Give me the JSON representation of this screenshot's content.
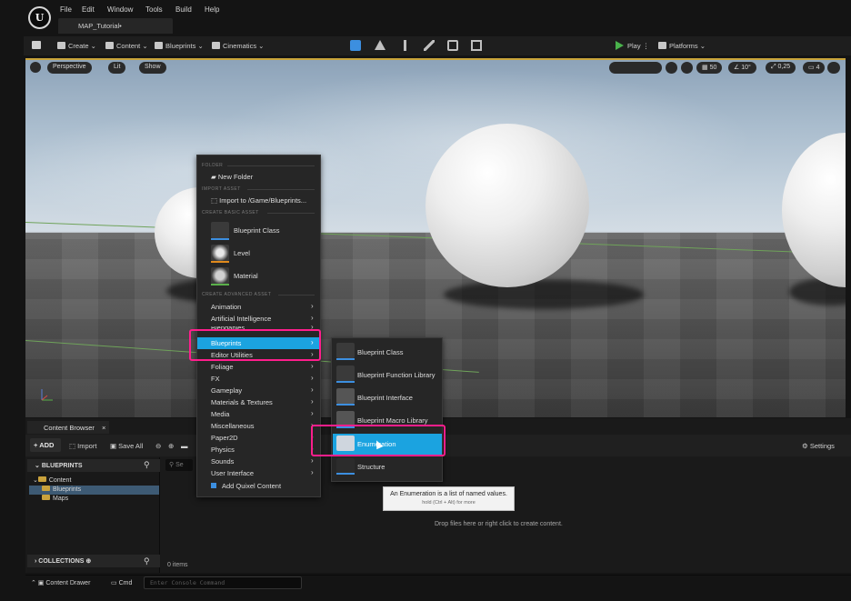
{
  "menubar": {
    "logo": "U",
    "items": [
      "File",
      "Edit",
      "Window",
      "Tools",
      "Build",
      "Help"
    ],
    "level_tab": "MAP_Tutorial•"
  },
  "toolbar": {
    "create": "Create",
    "content": "Content",
    "blueprints": "Blueprints",
    "cinematics": "Cinematics",
    "play": "Play",
    "platforms": "Platforms"
  },
  "viewport": {
    "perspective": "Perspective",
    "lit": "Lit",
    "show": "Show",
    "grid_snap": "50",
    "rot_snap": "10°",
    "scale_snap": "0,25",
    "camera_speed": "4",
    "accent_color": "#c9a43a"
  },
  "context_menu": {
    "sections": {
      "folder": "FOLDER",
      "import": "IMPORT ASSET",
      "basic": "CREATE BASIC ASSET",
      "advanced": "CREATE ADVANCED ASSET"
    },
    "new_folder": "New Folder",
    "import_to": "Import to /Game/Blueprints...",
    "basic_assets": [
      {
        "label": "Blueprint Class",
        "icon": "blueprint-class-icon",
        "color": "#3c8fe0"
      },
      {
        "label": "Level",
        "icon": "level-icon",
        "color": "#e08a1c"
      },
      {
        "label": "Material",
        "icon": "material-icon",
        "color": "#5ab04a"
      }
    ],
    "advanced_items": [
      {
        "label": "Animation",
        "submenu": true
      },
      {
        "label": "Artificial Intelligence",
        "submenu": true
      },
      {
        "label": "Blendables",
        "submenu": true
      },
      {
        "label": "Blueprints",
        "submenu": true,
        "highlighted": true
      },
      {
        "label": "Editor Utilities",
        "submenu": true
      },
      {
        "label": "Foliage",
        "submenu": true
      },
      {
        "label": "FX",
        "submenu": true
      },
      {
        "label": "Gameplay",
        "submenu": true
      },
      {
        "label": "Materials & Textures",
        "submenu": true
      },
      {
        "label": "Media",
        "submenu": true
      },
      {
        "label": "Miscellaneous",
        "submenu": true
      },
      {
        "label": "Paper2D",
        "submenu": true
      },
      {
        "label": "Physics",
        "submenu": true
      },
      {
        "label": "Sounds",
        "submenu": true
      },
      {
        "label": "User Interface",
        "submenu": true
      }
    ],
    "add_quixel": "Add Quixel Content",
    "highlight_color": "#1ba3e0"
  },
  "blueprints_submenu": {
    "items": [
      {
        "label": "Blueprint Class",
        "icon": "blueprint-class-icon"
      },
      {
        "label": "Blueprint Function Library",
        "icon": "function-library-icon"
      },
      {
        "label": "Blueprint Interface",
        "icon": "interface-icon"
      },
      {
        "label": "Blueprint Macro Library",
        "icon": "macro-library-icon"
      },
      {
        "label": "Enumeration",
        "icon": "enumeration-icon",
        "highlighted": true
      },
      {
        "label": "Structure",
        "icon": "structure-icon"
      }
    ]
  },
  "tooltip": {
    "title": "An Enumeration is a list of named values.",
    "hint": "hold (Ctrl + Alt) for more"
  },
  "content_browser": {
    "tab": "Content Browser",
    "add": "ADD",
    "import": "Import",
    "save_all": "Save All",
    "settings": "Settings",
    "tree_header": "BLUEPRINTS",
    "tree": [
      "Content",
      "Blueprints",
      "Maps"
    ],
    "collections": "COLLECTIONS",
    "search_placeholder": "Se",
    "drop_hint": "Drop files here or right click to create content.",
    "item_count": "0 items"
  },
  "statusbar": {
    "content_drawer": "Content Drawer",
    "cmd": "Cmd",
    "console_placeholder": "Enter Console Command"
  },
  "annotation_color": "#ff1e8c"
}
